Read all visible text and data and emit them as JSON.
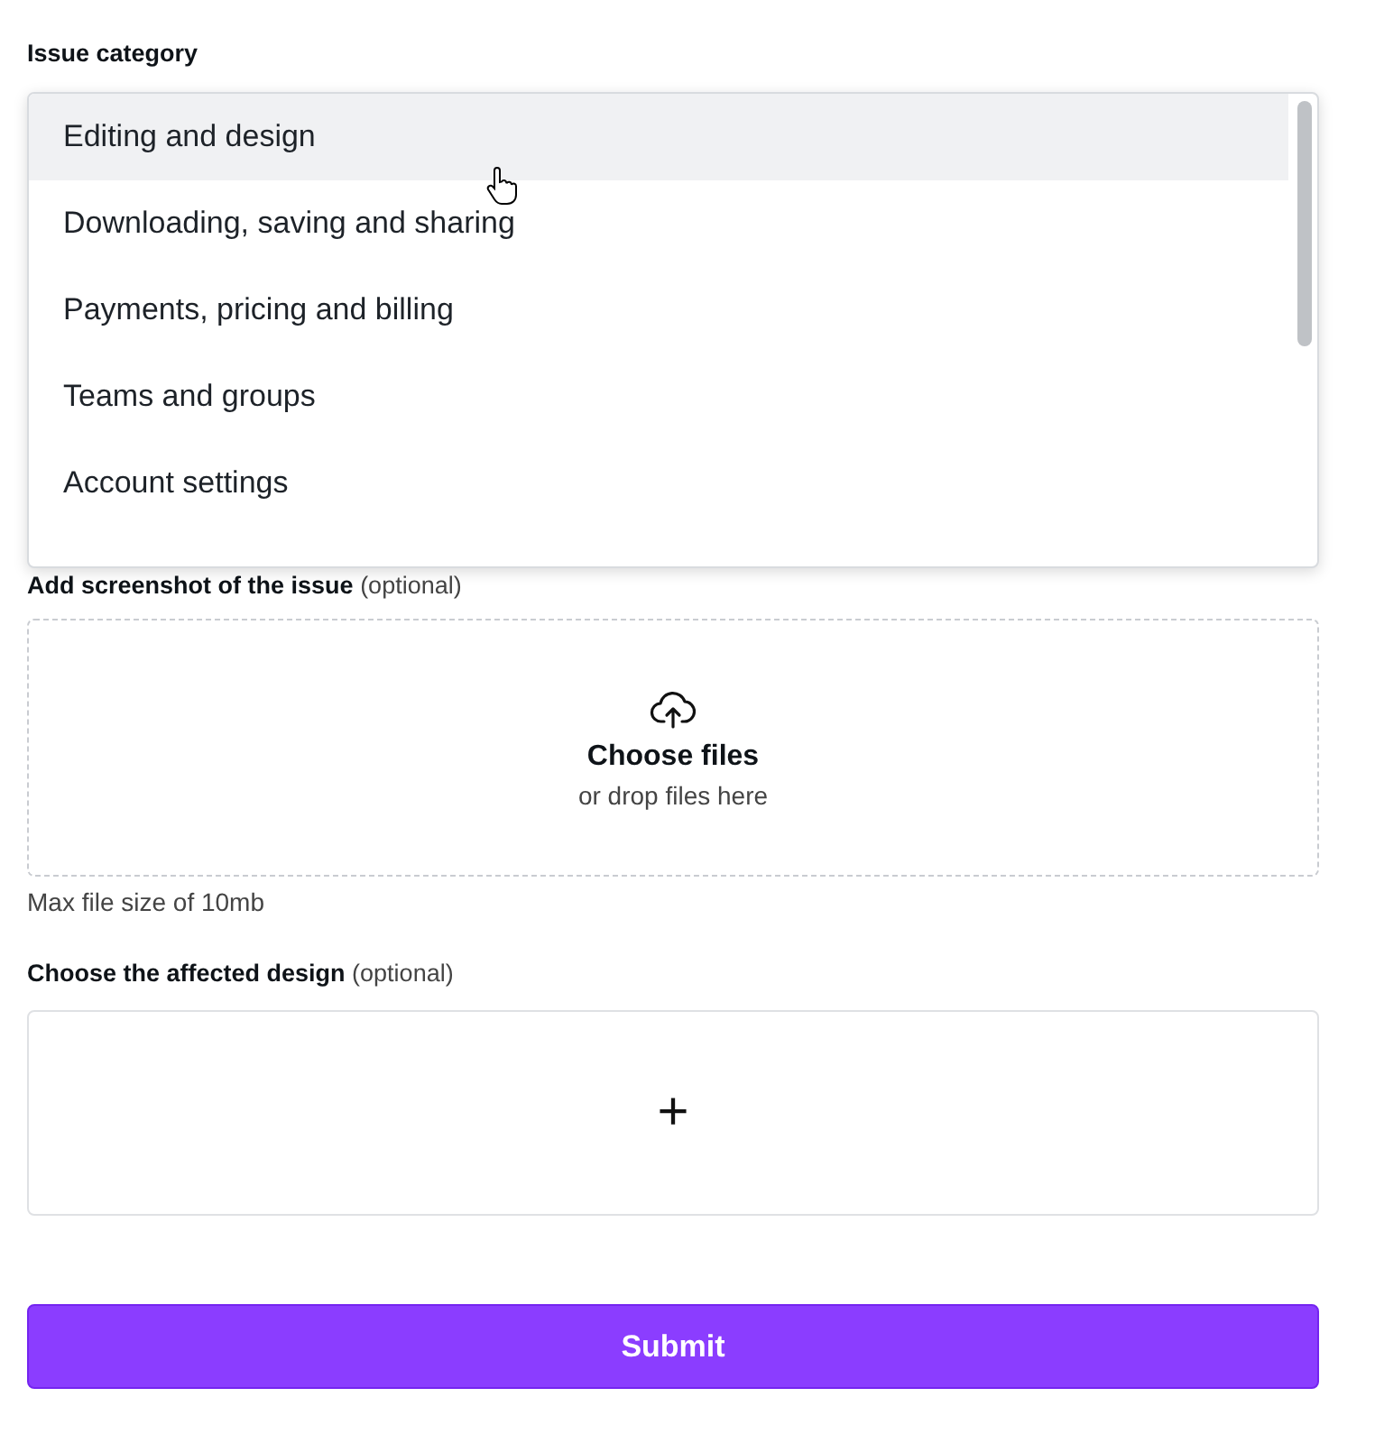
{
  "issue_category": {
    "label": "Issue category",
    "options": [
      {
        "label": "Editing and design",
        "highlighted": true
      },
      {
        "label": "Downloading, saving and sharing",
        "highlighted": false
      },
      {
        "label": "Payments, pricing and billing",
        "highlighted": false
      },
      {
        "label": "Teams and groups",
        "highlighted": false
      },
      {
        "label": "Account settings",
        "highlighted": false
      }
    ]
  },
  "screenshot": {
    "label": "Add screenshot of the issue",
    "optional": "(optional)",
    "button": "Choose files",
    "hint": "or drop files here",
    "note": "Max file size of 10mb"
  },
  "design": {
    "label": "Choose the affected design",
    "optional": "(optional)",
    "add": "+"
  },
  "submit": "Submit"
}
